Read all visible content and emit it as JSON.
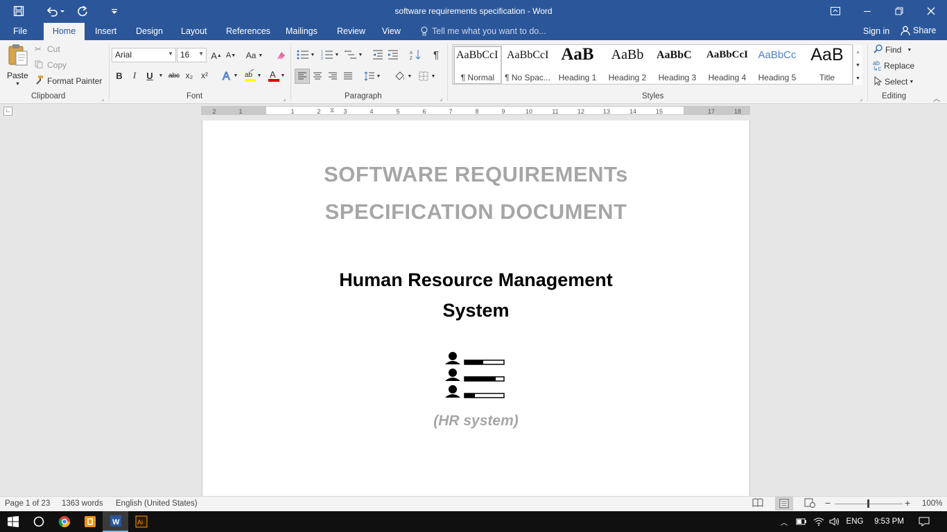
{
  "window": {
    "title": "software requirements specification - Word"
  },
  "qat": {
    "save": "save-icon",
    "undo": "undo-icon",
    "redo": "redo-icon",
    "customize": "customize-icon"
  },
  "tabs": [
    "File",
    "Home",
    "Insert",
    "Design",
    "Layout",
    "References",
    "Mailings",
    "Review",
    "View"
  ],
  "tellme": {
    "placeholder": "Tell me what you want to do..."
  },
  "account": {
    "signin": "Sign in",
    "share": "Share"
  },
  "clipboard": {
    "paste": "Paste",
    "cut": "Cut",
    "copy": "Copy",
    "format_painter": "Format Painter",
    "label": "Clipboard"
  },
  "font": {
    "name": "Arial",
    "size": "16",
    "change_case": "Aa",
    "bold": "B",
    "italic": "I",
    "underline": "U",
    "strike": "abc",
    "subscript": "x₂",
    "superscript": "x²",
    "label": "Font"
  },
  "paragraph": {
    "label": "Paragraph"
  },
  "styles": {
    "label": "Styles",
    "items": [
      {
        "preview": "AaBbCcI",
        "name": "¶ Normal"
      },
      {
        "preview": "AaBbCcI",
        "name": "¶ No Spac..."
      },
      {
        "preview": "AaB",
        "name": "Heading 1"
      },
      {
        "preview": "AaBb",
        "name": "Heading 2"
      },
      {
        "preview": "AaBbC",
        "name": "Heading 3"
      },
      {
        "preview": "AaBbCcI",
        "name": "Heading 4"
      },
      {
        "preview": "AaBbCc",
        "name": "Heading 5"
      },
      {
        "preview": "AaB",
        "name": "Title"
      }
    ]
  },
  "editing": {
    "find": "Find",
    "replace": "Replace",
    "select": "Select",
    "label": "Editing"
  },
  "ruler": {
    "labels": [
      "2",
      "1",
      "1",
      "2",
      "3",
      "4",
      "5",
      "6",
      "7",
      "8",
      "9",
      "10",
      "11",
      "12",
      "13",
      "14",
      "15",
      "17",
      "18"
    ]
  },
  "document": {
    "title_line1": "SOFTWARE REQUIREMENTs",
    "title_line2": "SPECIFICATION DOCUMENT",
    "subtitle_line1": "Human Resource Management",
    "subtitle_line2": "System",
    "caption": "(HR system)"
  },
  "status": {
    "page": "Page 1 of 23",
    "words": "1363 words",
    "language": "English (United States)",
    "zoom": "100%"
  },
  "taskbar": {
    "language": "ENG",
    "time": "9:53 PM"
  },
  "colors": {
    "ribbon_blue": "#2b579a",
    "title_gray": "#a6a6a6",
    "font_color_red": "#e00000",
    "highlight_yellow": "#ffff00"
  }
}
